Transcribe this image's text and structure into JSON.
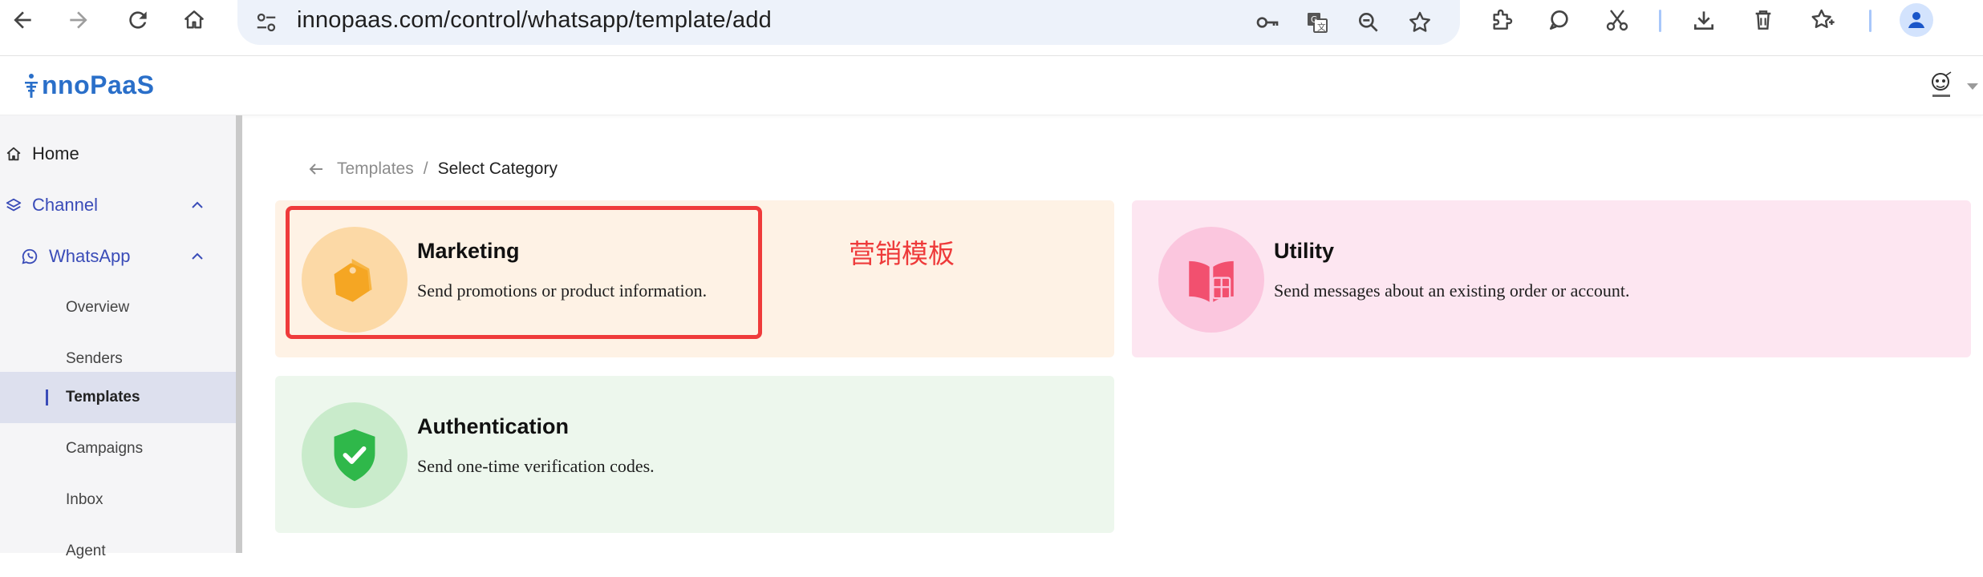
{
  "browser": {
    "url": "innopaas.com/control/whatsapp/template/add"
  },
  "app": {
    "logo_text": "nnoPaaS",
    "logo_colors": {
      "primary": "#2a6fc9"
    }
  },
  "sidebar": {
    "items": [
      {
        "label": "Home",
        "icon": "home-icon"
      },
      {
        "label": "Channel",
        "icon": "layers-icon",
        "expanded": true
      },
      {
        "label": "WhatsApp",
        "icon": "whatsapp-icon",
        "expanded": true
      }
    ],
    "sub_items": [
      {
        "label": "Overview"
      },
      {
        "label": "Senders"
      },
      {
        "label": "Templates",
        "active": true
      },
      {
        "label": "Campaigns"
      },
      {
        "label": "Inbox"
      },
      {
        "label": "Agent"
      }
    ],
    "accent_color": "#3a4cb8"
  },
  "breadcrumb": {
    "parent": "Templates",
    "separator": "/",
    "current": "Select Category"
  },
  "categories": [
    {
      "title": "Marketing",
      "description": "Send promotions or product information.",
      "icon": "price-tag-icon",
      "color": "#f5a623"
    },
    {
      "title": "Utility",
      "description": "Send messages about an existing order or account.",
      "icon": "book-icon",
      "color": "#f2506f"
    },
    {
      "title": "Authentication",
      "description": "Send one-time verification codes.",
      "icon": "shield-check-icon",
      "color": "#2fb84a"
    }
  ],
  "annotation": {
    "text": "营销模板",
    "color": "#ee3a3a"
  }
}
